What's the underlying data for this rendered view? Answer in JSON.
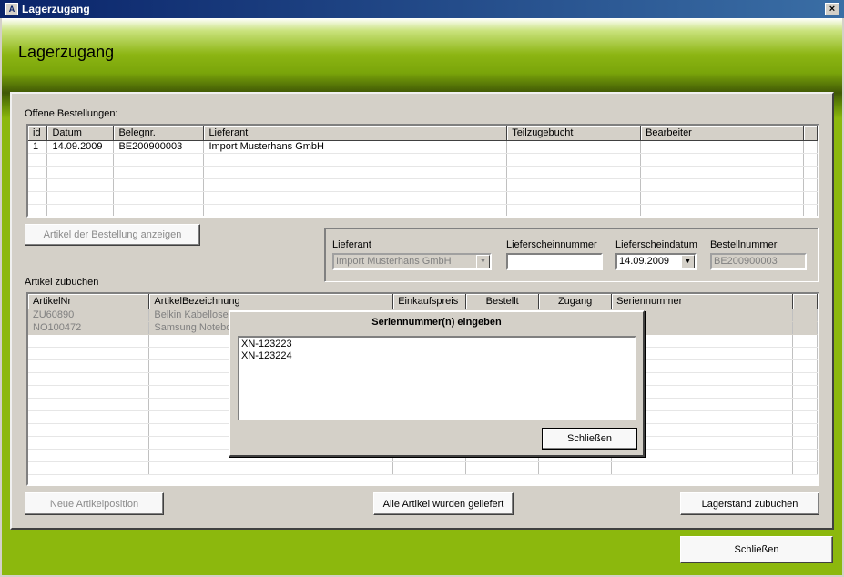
{
  "window": {
    "title": "Lagerzugang",
    "app_icon": "A",
    "close_glyph": "×"
  },
  "header": {
    "title": "Lagerzugang"
  },
  "orders": {
    "label": "Offene Bestellungen:",
    "columns": [
      "id",
      "Datum",
      "Belegnr.",
      "Lieferant",
      "Teilzugebucht",
      "Bearbeiter"
    ],
    "rows": [
      [
        "1",
        "14.09.2009",
        "BE200900003",
        "Import Musterhans GmbH",
        "",
        ""
      ]
    ]
  },
  "show_articles_button": "Artikel der Bestellung anzeigen",
  "delivery": {
    "supplier_label": "Lieferant",
    "supplier_value": "Import Musterhans GmbH",
    "note_number_label": "Lieferscheinnummer",
    "note_number_value": "",
    "note_date_label": "Lieferscheindatum",
    "note_date_value": "14.09.2009",
    "order_number_label": "Bestellnummer",
    "order_number_value": "BE200900003"
  },
  "articles": {
    "label": "Artikel zubuchen",
    "columns": [
      "ArtikelNr",
      "ArtikelBezeichnung",
      "Einkaufspreis",
      "Bestellt",
      "Zugang",
      "Seriennummer"
    ],
    "rows": [
      [
        "ZU60890",
        "Belkin Kabellose",
        "",
        "",
        "",
        ""
      ],
      [
        "NO100472",
        "Samsung Notebo",
        "",
        "",
        "",
        ""
      ]
    ]
  },
  "buttons": {
    "new_position": "Neue Artikelposition",
    "all_delivered": "Alle Artikel wurden geliefert",
    "book_stock": "Lagerstand zubuchen",
    "close": "Schließen"
  },
  "serial_dialog": {
    "title": "Seriennummer(n) eingeben",
    "lines": [
      "XN-123223",
      "XN-123224"
    ],
    "close_button": "Schließen"
  },
  "icons": {
    "combo_arrow": "▼"
  }
}
